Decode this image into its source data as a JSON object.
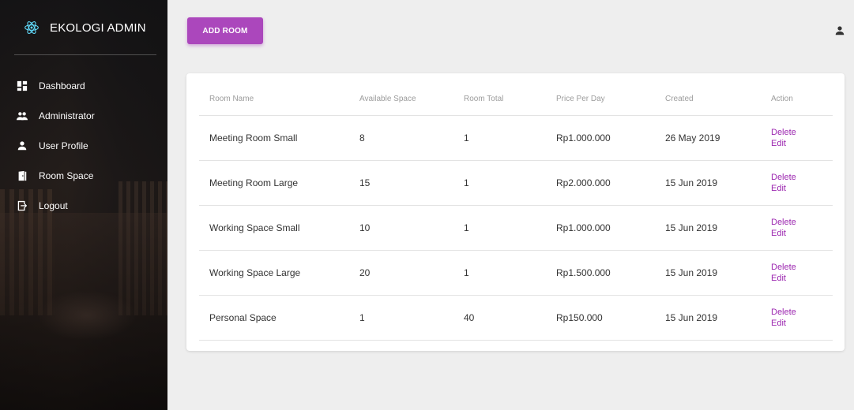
{
  "brand": {
    "title": "EKOLOGI ADMIN",
    "logo_icon": "react-atom-icon",
    "logo_color": "#61dafb"
  },
  "sidebar": {
    "items": [
      {
        "label": "Dashboard",
        "icon": "dashboard-icon"
      },
      {
        "label": "Administrator",
        "icon": "people-icon"
      },
      {
        "label": "User Profile",
        "icon": "person-icon"
      },
      {
        "label": "Room Space",
        "icon": "door-icon"
      },
      {
        "label": "Logout",
        "icon": "logout-icon"
      }
    ]
  },
  "toolbar": {
    "add_label": "ADD ROOM",
    "accent": "#ab47bc"
  },
  "header": {
    "user_icon": "person-icon"
  },
  "table": {
    "headers": [
      "Room Name",
      "Available Space",
      "Room Total",
      "Price Per Day",
      "Created",
      "Action"
    ],
    "rows": [
      {
        "name": "Meeting Room Small",
        "available": "8",
        "total": "1",
        "price": "Rp1.000.000",
        "created": "26 May 2019",
        "delete": "Delete",
        "edit": "Edit"
      },
      {
        "name": "Meeting Room Large",
        "available": "15",
        "total": "1",
        "price": "Rp2.000.000",
        "created": "15 Jun 2019",
        "delete": "Delete",
        "edit": "Edit"
      },
      {
        "name": "Working Space Small",
        "available": "10",
        "total": "1",
        "price": "Rp1.000.000",
        "created": "15 Jun 2019",
        "delete": "Delete",
        "edit": "Edit"
      },
      {
        "name": "Working Space Large",
        "available": "20",
        "total": "1",
        "price": "Rp1.500.000",
        "created": "15 Jun 2019",
        "delete": "Delete",
        "edit": "Edit"
      },
      {
        "name": "Personal Space",
        "available": "1",
        "total": "40",
        "price": "Rp150.000",
        "created": "15 Jun 2019",
        "delete": "Delete",
        "edit": "Edit"
      }
    ],
    "link_color": "#9c27b0"
  }
}
